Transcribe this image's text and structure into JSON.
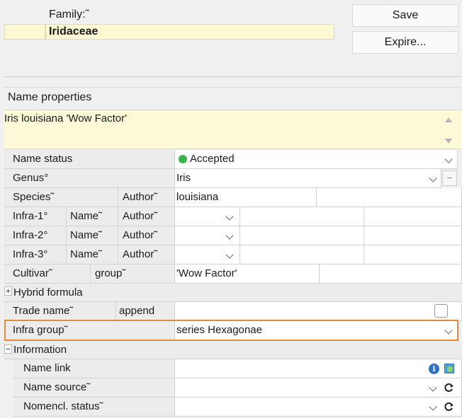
{
  "header": {
    "family_label": "Family:˜",
    "family_value": "Iridaceae",
    "save_button": "Save",
    "expire_button": "Expire..."
  },
  "name_properties": {
    "section_title": "Name properties",
    "full_name": "Iris louisiana 'Wow Factor'"
  },
  "rows": {
    "name_status": {
      "label": "Name status",
      "value": "Accepted",
      "status_color": "#3cb44b"
    },
    "genus": {
      "label": "Genus°",
      "value": "Iris"
    },
    "species": {
      "label": "Species˜",
      "author_label": "Author˜",
      "value": "louisiana"
    },
    "infra1": {
      "label": "Infra-1°",
      "name_label": "Name˜",
      "author_label": "Author˜"
    },
    "infra2": {
      "label": "Infra-2°",
      "name_label": "Name˜",
      "author_label": "Author˜"
    },
    "infra3": {
      "label": "Infra-3°",
      "name_label": "Name˜",
      "author_label": "Author˜"
    },
    "cultivar": {
      "label": "Cultivar˜",
      "group_label": "group˜",
      "value": "'Wow Factor'"
    },
    "hybrid_formula": {
      "label": "Hybrid formula",
      "expander": "+"
    },
    "trade_name": {
      "label": "Trade name˜",
      "append_label": "append"
    },
    "infra_group": {
      "label": "Infra group˜",
      "value": "series Hexagonae",
      "highlight_color": "#e08a3c"
    },
    "information": {
      "label": "Information",
      "expander": "−"
    },
    "name_link": {
      "label": "Name link"
    },
    "name_source": {
      "label": "Name source˜"
    },
    "nomencl_status": {
      "label": "Nomencl. status˜"
    }
  },
  "icons": [
    "info-icon",
    "globe-link-icon",
    "refresh-icon",
    "chevron-down-icon",
    "minus-icon",
    "scroll-up-icon",
    "scroll-down-icon"
  ]
}
